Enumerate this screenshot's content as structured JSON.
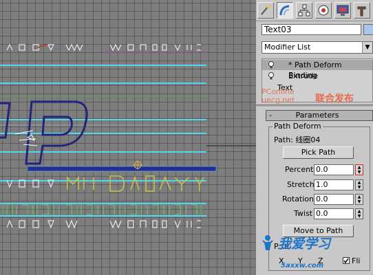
{
  "viewport": {
    "colors": {
      "background": "#7d7d7d",
      "cyan_line": "#4fd8ef",
      "path_blue": "#23237a",
      "text_white": "#e8e8ee",
      "yellow_text": "#c8c04a",
      "green_line": "#3fb23f",
      "red_line": "#c03030"
    }
  },
  "panel": {
    "tabs": [
      {
        "name": "create-tab",
        "icon": "create-icon"
      },
      {
        "name": "modify-tab",
        "icon": "modify-icon"
      },
      {
        "name": "hierarchy-tab",
        "icon": "hierarchy-icon"
      },
      {
        "name": "motion-tab",
        "icon": "motion-icon"
      },
      {
        "name": "display-tab",
        "icon": "display-icon"
      },
      {
        "name": "utilities-tab",
        "icon": "utilities-icon"
      }
    ],
    "object_name": "Text03",
    "modifier_list_label": "Modifier List",
    "stack": [
      {
        "label": "* Path Deform Binding",
        "selected": true
      },
      {
        "label": "Extrude",
        "selected": false
      },
      {
        "label": "Text",
        "selected": false
      }
    ],
    "watermark_1_line1": "PConline",
    "watermark_1_line2": "uecg.net",
    "watermark_2": "联合发布",
    "rollout": {
      "toggle": "-",
      "title": "Parameters",
      "group_title": "Path Deform",
      "path_label": "Path: 线圈04",
      "pick_path_button": "Pick Path",
      "percent_label": "Percent",
      "percent_value": "0.0",
      "stretch_label": "Stretch",
      "stretch_value": "1.0",
      "rotation_label": "Rotation",
      "rotation_value": "0.0",
      "twist_label": "Twist",
      "twist_value": "0.0",
      "move_to_path_button": "Move to Path",
      "axis_group_fragment": "P...s",
      "axis_x": "X",
      "axis_y": "Y",
      "axis_z": "Z",
      "flip_label": "Fli"
    },
    "site_logo_text": "我爱学习",
    "site_logo_url": "5axxw.com"
  }
}
